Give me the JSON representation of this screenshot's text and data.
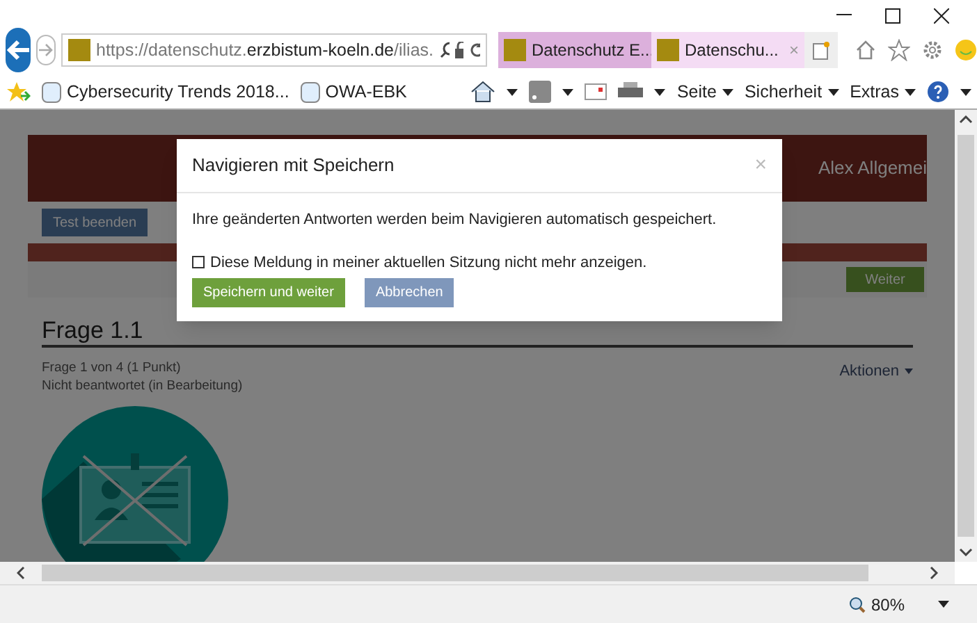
{
  "address_bar": {
    "url": "https://datenschutz.**erzbistum-koeln.de**/ilias."
  },
  "tabs": [
    {
      "label": "Datenschutz E...",
      "selected": false
    },
    {
      "label": "Datenschu...",
      "selected": true,
      "close": "×"
    }
  ],
  "favorites": [
    {
      "label": "Cybersecurity Trends 2018..."
    },
    {
      "label": "OWA-EBK"
    }
  ],
  "menus": [
    "Seite",
    "Sicherheit",
    "Extras"
  ],
  "page": {
    "user": "Alex Allgemei",
    "end_button": "Test beenden",
    "next_button": "Weiter",
    "question_title": "Frage 1.1",
    "question_info": "Frage 1 von 4 (1 Punkt)",
    "question_status": "Nicht beantwortet (in Bearbeitung)",
    "actions": "Aktionen"
  },
  "dialog": {
    "title": "Navigieren mit Speichern",
    "close": "×",
    "message": "Ihre geänderten Antworten werden beim Navigieren automatisch gespeichert.",
    "checkbox": {
      "label": "Diese Meldung in meiner aktuellen Sitzung nicht mehr anzeigen.",
      "checked": false
    },
    "buttons": [
      {
        "label": "Speichern und weiter",
        "kind": "primary"
      },
      {
        "label": "Abbrechen",
        "kind": "secondary"
      }
    ]
  },
  "status_bar": {
    "zoom": "80%"
  }
}
